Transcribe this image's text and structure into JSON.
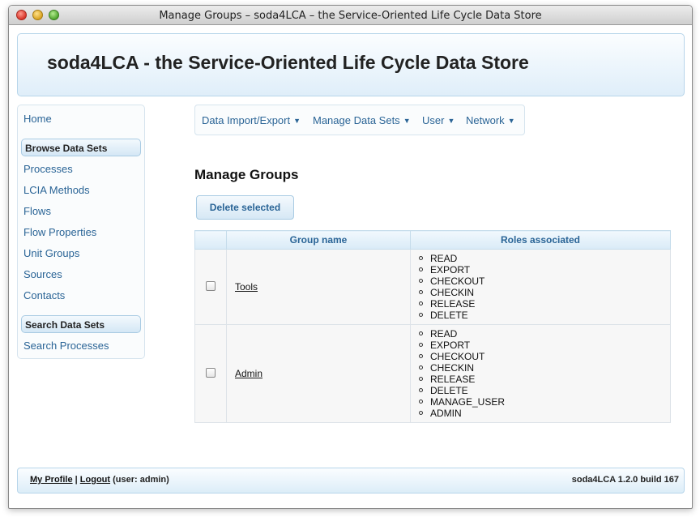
{
  "window": {
    "title": "Manage Groups – soda4LCA – the Service-Oriented Life Cycle Data Store"
  },
  "header": {
    "title": "soda4LCA - the Service-Oriented Life Cycle Data Store"
  },
  "sidebar": {
    "home": "Home",
    "browse_heading": "Browse Data Sets",
    "browse_items": [
      "Processes",
      "LCIA Methods",
      "Flows",
      "Flow Properties",
      "Unit Groups",
      "Sources",
      "Contacts"
    ],
    "search_heading": "Search Data Sets",
    "search_items": [
      "Search Processes"
    ]
  },
  "nav": {
    "items": [
      "Data Import/Export",
      "Manage Data Sets",
      "User",
      "Network"
    ],
    "caret": "▼"
  },
  "main": {
    "title": "Manage Groups",
    "delete_button": "Delete selected",
    "table": {
      "headers": [
        "",
        "Group name",
        "Roles associated"
      ],
      "rows": [
        {
          "name": "Tools",
          "roles": [
            "READ",
            "EXPORT",
            "CHECKOUT",
            "CHECKIN",
            "RELEASE",
            "DELETE"
          ]
        },
        {
          "name": "Admin",
          "roles": [
            "READ",
            "EXPORT",
            "CHECKOUT",
            "CHECKIN",
            "RELEASE",
            "DELETE",
            "MANAGE_USER",
            "ADMIN"
          ]
        }
      ]
    }
  },
  "footer": {
    "my_profile": "My Profile",
    "separator": "|",
    "logout": "Logout",
    "user_text": "(user: admin)",
    "version": "soda4LCA 1.2.0 build 167"
  }
}
